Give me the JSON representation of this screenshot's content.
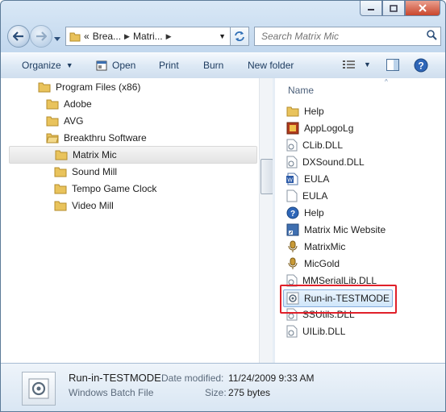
{
  "address": {
    "overflow": "«",
    "crumbs": [
      "Brea...",
      "Matri..."
    ]
  },
  "search": {
    "placeholder": "Search Matrix Mic"
  },
  "toolbar": {
    "organize": "Organize",
    "open": "Open",
    "print": "Print",
    "burn": "Burn",
    "new_folder": "New folder"
  },
  "tree": [
    {
      "label": "Program Files (x86)"
    },
    {
      "label": "Adobe"
    },
    {
      "label": "AVG"
    },
    {
      "label": "Breakthru Software"
    },
    {
      "label": "Matrix Mic"
    },
    {
      "label": "Sound Mill"
    },
    {
      "label": "Tempo Game Clock"
    },
    {
      "label": "Video Mill"
    }
  ],
  "files": {
    "column_header": "Name",
    "items": [
      {
        "name": "Help",
        "icon": "folder-icon"
      },
      {
        "name": "AppLogoLg",
        "icon": "image-icon"
      },
      {
        "name": "CLib.DLL",
        "icon": "dll-icon"
      },
      {
        "name": "DXSound.DLL",
        "icon": "dll-icon"
      },
      {
        "name": "EULA",
        "icon": "word-document-icon"
      },
      {
        "name": "EULA",
        "icon": "text-document-icon"
      },
      {
        "name": "Help",
        "icon": "help-icon"
      },
      {
        "name": "Matrix Mic Website",
        "icon": "shortcut-icon"
      },
      {
        "name": "MatrixMic",
        "icon": "microphone-app-icon"
      },
      {
        "name": "MicGold",
        "icon": "microphone-app-icon"
      },
      {
        "name": "MMSerialLib.DLL",
        "icon": "dll-icon"
      },
      {
        "name": "Run-in-TESTMODE",
        "icon": "batch-file-icon"
      },
      {
        "name": "SSUtils.DLL",
        "icon": "dll-icon"
      },
      {
        "name": "UILib.DLL",
        "icon": "dll-icon"
      }
    ]
  },
  "details": {
    "name": "Run-in-TESTMODE",
    "type": "Windows Batch File",
    "date_label": "Date modified:",
    "date_value": "11/24/2009 9:33 AM",
    "size_label": "Size:",
    "size_value": "275 bytes"
  },
  "colors": {
    "highlight": "#e0202a",
    "accent": "#1e3c60"
  }
}
